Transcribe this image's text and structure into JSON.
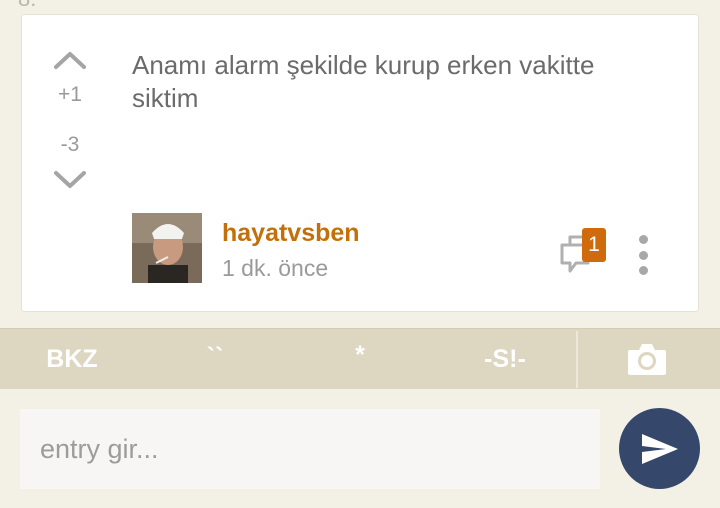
{
  "top_partial_text": "8.",
  "entry": {
    "text": "Anamı alarm şekilde kurup erken vakitte siktim",
    "upvotes": "+1",
    "downvotes": "-3",
    "author": "hayatvsben",
    "timestamp": "1 dk. önce",
    "comment_count": "1"
  },
  "icons": {
    "vote_up": "chevron-up-icon",
    "vote_down": "chevron-down-icon",
    "comments": "speech-bubbles-icon",
    "more": "vertical-dots-icon",
    "camera": "camera-icon",
    "send": "paper-plane-icon"
  },
  "format_bar": {
    "bkz": "BKZ",
    "tick": "``",
    "star": "*",
    "spoiler": "-S!-"
  },
  "composer": {
    "placeholder": "entry gir..."
  },
  "colors": {
    "author": "#c3700a",
    "badge": "#d06b0d",
    "format_bar": "#ddd6c1",
    "send_button": "#35486b",
    "background": "#f3f0e6"
  }
}
